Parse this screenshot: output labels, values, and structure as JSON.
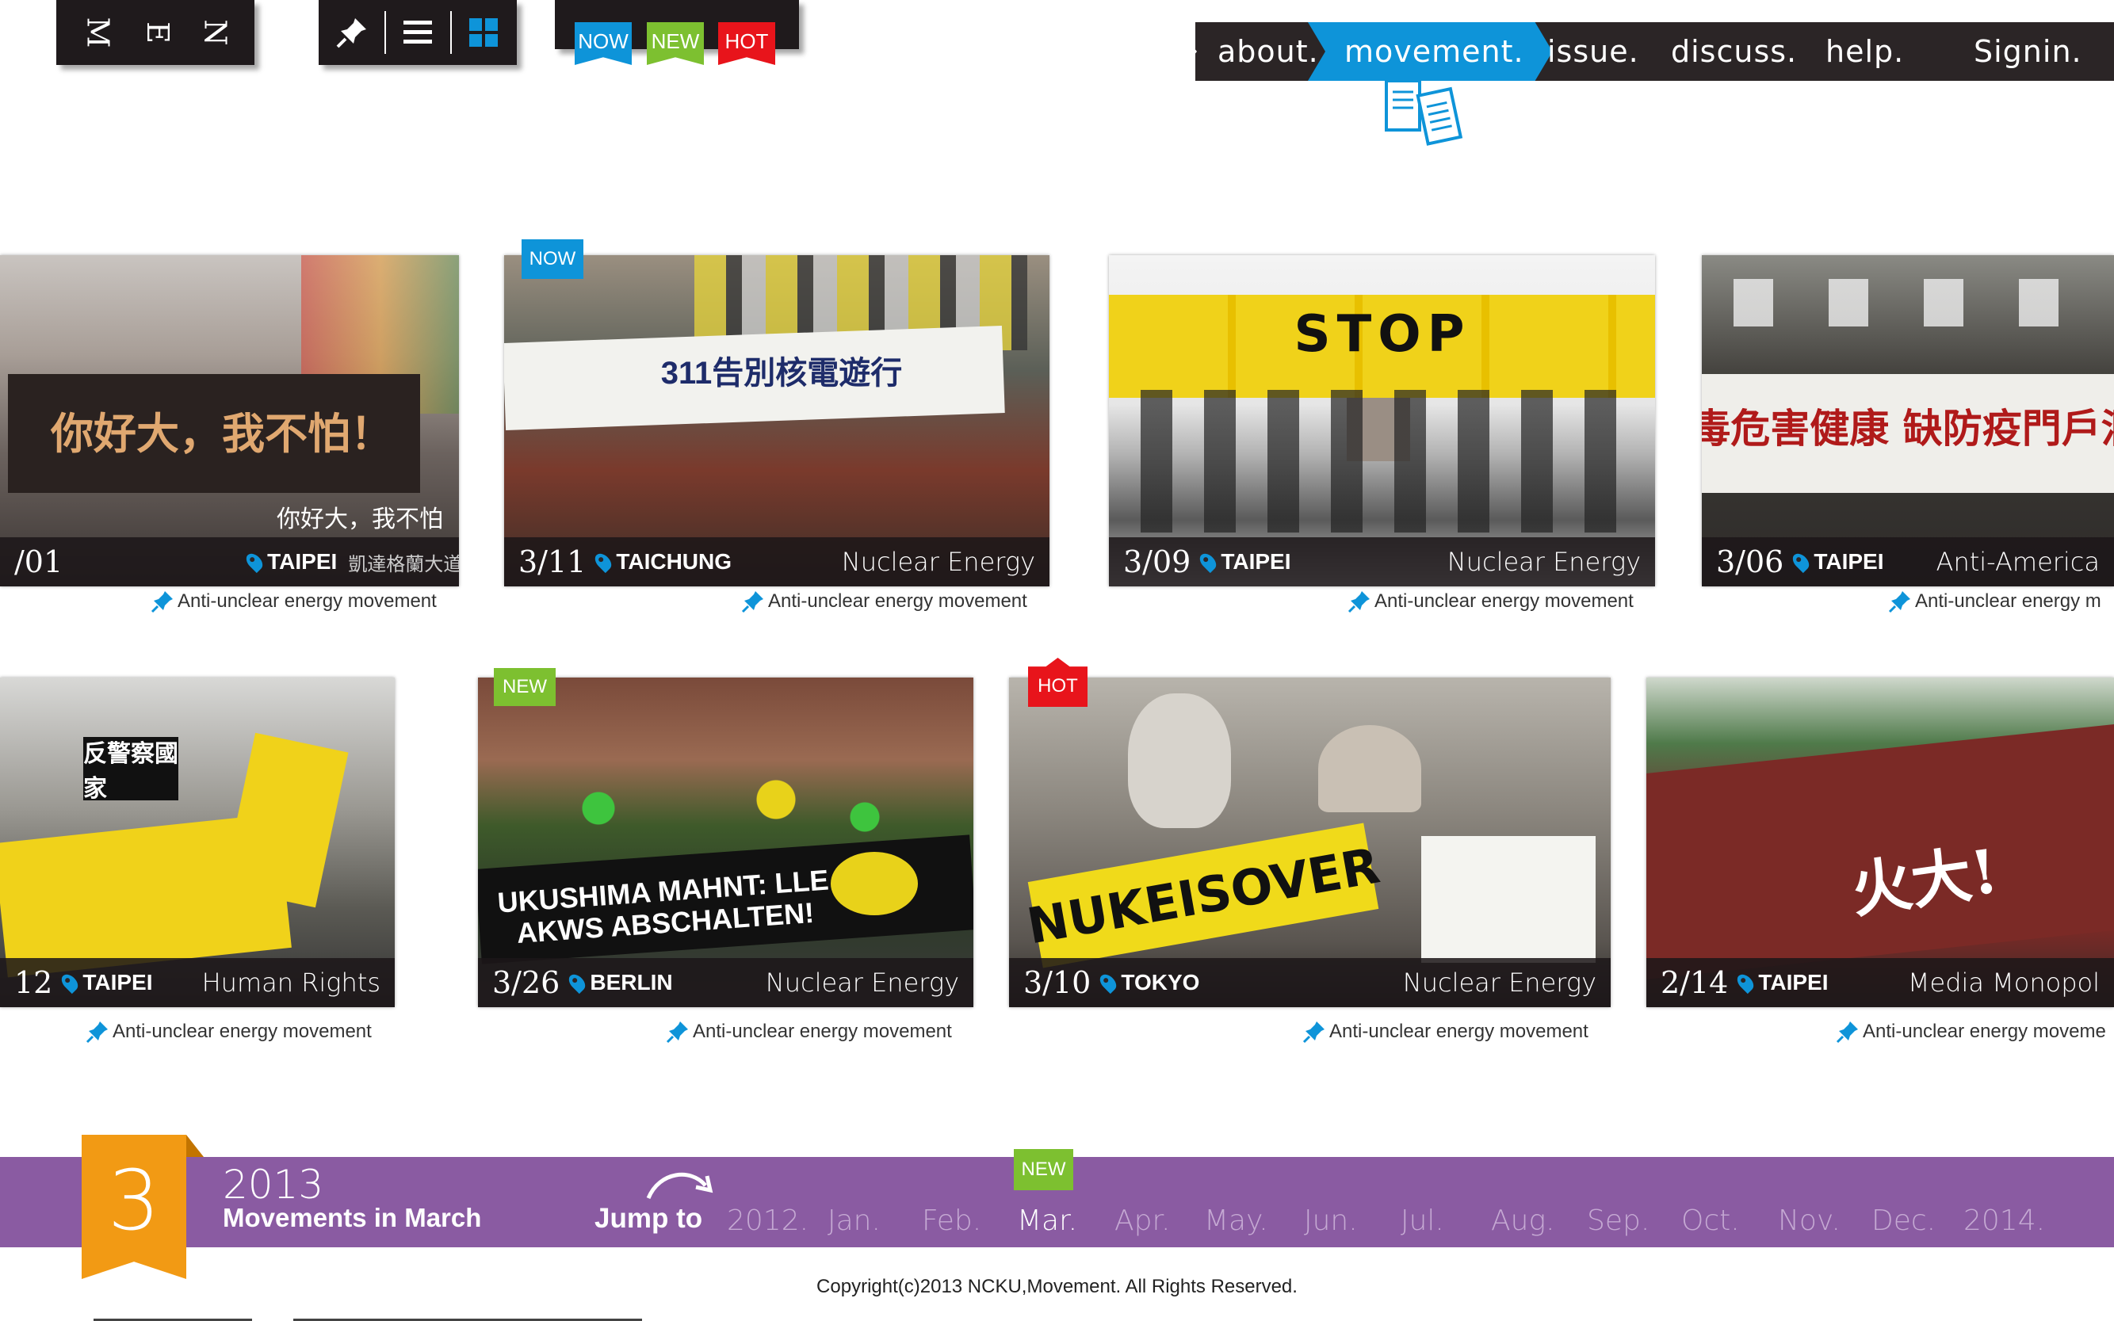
{
  "menu": {
    "letters": [
      "M",
      "E",
      "N"
    ]
  },
  "toolbar": {
    "pin_icon": "pin-icon",
    "list_icon": "list-icon",
    "grid_icon": "grid-icon"
  },
  "tags": {
    "now": "NOW",
    "new": "NEW",
    "hot": "HOT"
  },
  "nav": {
    "items": [
      "about.",
      "movement.",
      "issue.",
      "discuss.",
      "help.",
      "Signin."
    ],
    "active": "movement."
  },
  "colors": {
    "accent_blue": "#0e94d9",
    "new_green": "#7dc030",
    "hot_red": "#e8141b",
    "bar_purple": "#8a5ba2",
    "ribbon_orange": "#f29a14",
    "dark": "#1f1a1c"
  },
  "row1": [
    {
      "date": "/01",
      "city": "TAIPEI",
      "sub": "凱達格蘭大道",
      "caption": "你好大，我不怕",
      "banner": "你好大，我不怕！",
      "tagline": "Anti-unclear energy movement"
    },
    {
      "badge": "NOW",
      "date": "3/11",
      "city": "TAICHUNG",
      "topic": "Nuclear Energy",
      "banner": "311告別核電遊行",
      "tagline": "Anti-unclear energy movement"
    },
    {
      "date": "3/09",
      "city": "TAIPEI",
      "topic": "Nuclear Energy",
      "banner": "STOP",
      "tagline": "Anti-unclear energy movement"
    },
    {
      "date": "3/06",
      "city": "TAIPEI",
      "topic": "Anti-America",
      "banner": "毒危害健康 缺防疫門戶洞",
      "tagline": "Anti-unclear energy m"
    }
  ],
  "row2": [
    {
      "date": "12",
      "city": "TAIPEI",
      "topic": "Human Rights",
      "banner": "反警察國家",
      "tagline": "Anti-unclear energy movement"
    },
    {
      "badge": "NEW",
      "date": "3/26",
      "city": "BERLIN",
      "topic": "Nuclear Energy",
      "banner": "UKUSHIMA MAHNT: LLE AKWS ABSCHALTEN!",
      "tagline": "Anti-unclear energy movement"
    },
    {
      "badge": "HOT",
      "date": "3/10",
      "city": "TOKYO",
      "topic": "Nuclear Energy",
      "banner": "NUKEISOVER",
      "tagline": "Anti-unclear energy movement"
    },
    {
      "date": "2/14",
      "city": "TAIPEI",
      "topic": "Media Monopol",
      "banner": "火大!",
      "tagline": "Anti-unclear energy moveme"
    }
  ],
  "timeline": {
    "current_month_number": "3",
    "year": "2013",
    "title": "Movements in March",
    "jump_label": "Jump to",
    "months": [
      "2012.",
      "Jan.",
      "Feb.",
      "Mar.",
      "Apr.",
      "May.",
      "Jun.",
      "Jul.",
      "Aug.",
      "Sep.",
      "Oct.",
      "Nov.",
      "Dec.",
      "2014."
    ],
    "active_month": "Mar.",
    "active_badge": "NEW"
  },
  "footer": {
    "copyright": "Copyright(c)2013 NCKU,Movement. All Rights Reserved."
  }
}
